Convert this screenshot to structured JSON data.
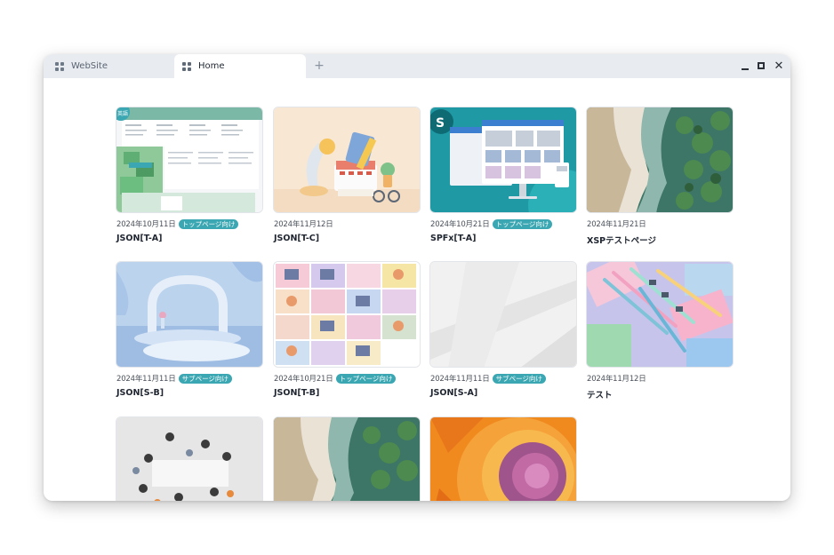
{
  "tabs": [
    {
      "label": "WebSite",
      "icon": "grid-icon"
    },
    {
      "label": "Home",
      "icon": "grid-icon"
    }
  ],
  "new_tab_symbol": "+",
  "window_controls": {
    "minimize": "minimize-icon",
    "maximize": "maximize-icon",
    "close": "✕"
  },
  "badge_color": "#3ba7b2",
  "cards": [
    {
      "date": "2024年10月11日",
      "badge": "トップページ向け",
      "title": "JSON[T-A]",
      "corner_badge": "英語"
    },
    {
      "date": "2024年11月12日",
      "badge": "",
      "title": "JSON[T-C]"
    },
    {
      "date": "2024年10月21日",
      "badge": "トップページ向け",
      "title": "SPFx[T-A]",
      "corner_badge": "S"
    },
    {
      "date": "2024年11月21日",
      "badge": "",
      "title": "XSPテストページ"
    },
    {
      "date": "2024年11月11日",
      "badge": "サブページ向け",
      "title": "JSON[S-B]"
    },
    {
      "date": "2024年10月21日",
      "badge": "トップページ向け",
      "title": "JSON[T-B]"
    },
    {
      "date": "2024年11月11日",
      "badge": "サブページ向け",
      "title": "JSON[S-A]"
    },
    {
      "date": "2024年11月12日",
      "badge": "",
      "title": "テスト"
    },
    {
      "date": "",
      "badge": "",
      "title": ""
    },
    {
      "date": "",
      "badge": "",
      "title": ""
    },
    {
      "date": "",
      "badge": "",
      "title": ""
    }
  ]
}
